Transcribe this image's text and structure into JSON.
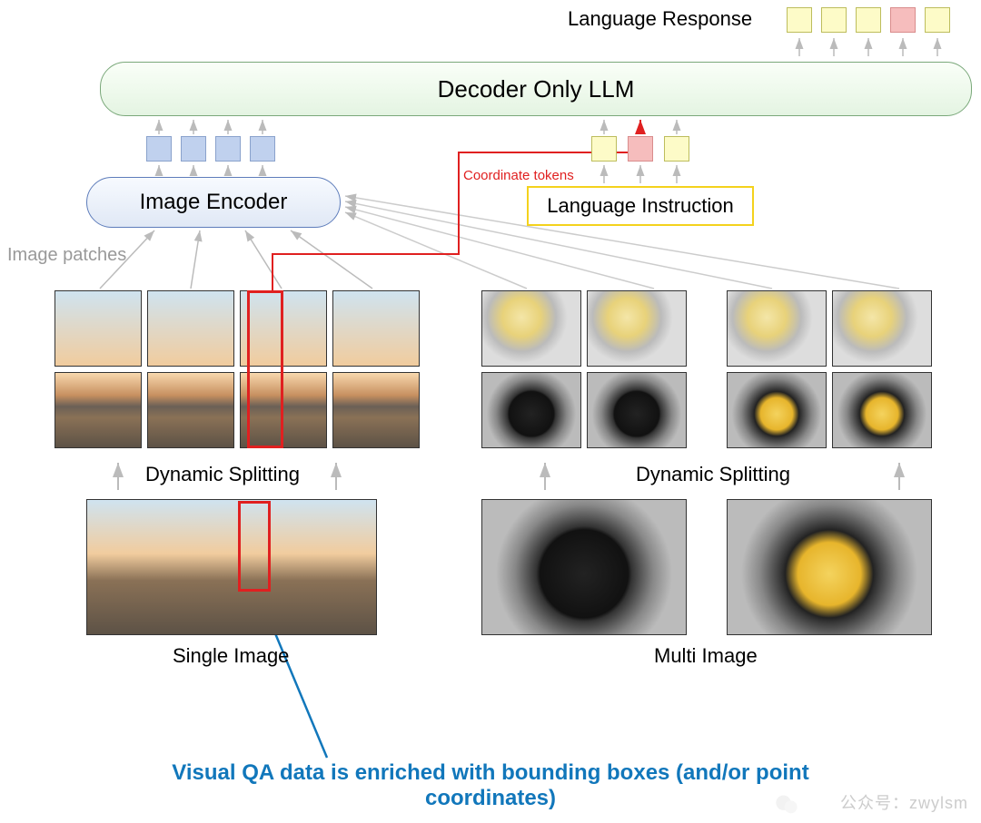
{
  "top_label": "Language Response",
  "decoder_label": "Decoder Only LLM",
  "encoder_label": "Image Encoder",
  "patches_label": "Image patches",
  "coord_tokens_label": "Coordinate tokens",
  "lang_instruction_label": "Language Instruction",
  "dynamic_splitting_label": "Dynamic Splitting",
  "single_image_label": "Single Image",
  "multi_image_label": "Multi Image",
  "qa_caption": "Visual QA data is enriched with bounding boxes (and/or point coordinates)",
  "watermark": "公众号：zwylsm",
  "output_tokens": [
    "yellow",
    "yellow",
    "yellow",
    "pink",
    "yellow"
  ],
  "vision_tokens": [
    "blue",
    "blue",
    "blue",
    "blue"
  ],
  "lang_tokens": [
    "yellow",
    "pink",
    "yellow"
  ]
}
